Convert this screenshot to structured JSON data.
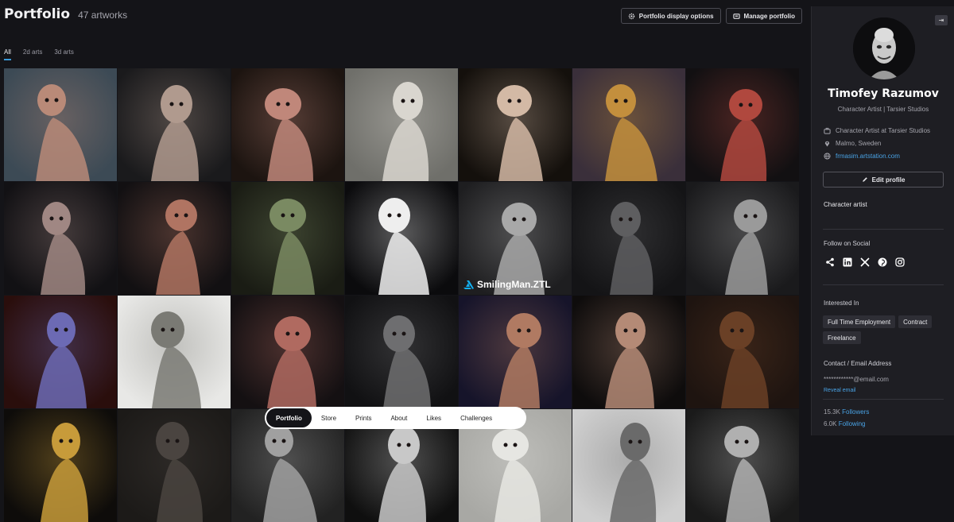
{
  "header": {
    "title": "Portfolio",
    "count": "47 artworks",
    "display_options_label": "Portfolio display options",
    "manage_label": "Manage portfolio"
  },
  "tabs": [
    {
      "label": "All",
      "active": true
    },
    {
      "label": "2d arts",
      "active": false
    },
    {
      "label": "3d arts",
      "active": false
    }
  ],
  "grid": {
    "tile_palettes": [
      [
        "#3c4a55",
        "#b98a78"
      ],
      [
        "#1a1a1c",
        "#b09a8e"
      ],
      [
        "#1c1410",
        "#c0877a"
      ],
      [
        "#6f6f6a",
        "#d9d6cf"
      ],
      [
        "#14100c",
        "#d3b9a5"
      ],
      [
        "#3a2f3a",
        "#c38f3d"
      ],
      [
        "#121012",
        "#b0483e"
      ],
      [
        "#121114",
        "#a08783"
      ],
      [
        "#121012",
        "#b07462"
      ],
      [
        "#1a1c14",
        "#7a8a62"
      ],
      [
        "#0b0b0d",
        "#eeeeee"
      ],
      [
        "#1e1e20",
        "#a8a8a8"
      ],
      [
        "#141416",
        "#5e5e60"
      ],
      [
        "#1a1a1c",
        "#9a9a9a"
      ],
      [
        "#2a0e0c",
        "#6c6ab4"
      ],
      [
        "#e8e8e6",
        "#7a7a74"
      ],
      [
        "#141012",
        "#b06a60"
      ],
      [
        "#111113",
        "#6e6e70"
      ],
      [
        "#16142a",
        "#b07a62"
      ],
      [
        "#0e0c0c",
        "#b48a76"
      ],
      [
        "#1e1410",
        "#6a4026"
      ],
      [
        "#0e0c0a",
        "#c79b3a"
      ],
      [
        "#1c1a18",
        "#4a4440"
      ],
      [
        "#222222",
        "#a0a0a0"
      ],
      [
        "#0f0f0f",
        "#c8c8c8"
      ],
      [
        "#a8a8a4",
        "#e6e6e2"
      ],
      [
        "#cfcfcf",
        "#6a6a6a"
      ],
      [
        "#1a1a1a",
        "#b0b0b0"
      ]
    ],
    "watermark": "SmilingMan.ZTL"
  },
  "bottom_nav": [
    {
      "label": "Portfolio",
      "active": true
    },
    {
      "label": "Store",
      "active": false
    },
    {
      "label": "Prints",
      "active": false
    },
    {
      "label": "About",
      "active": false
    },
    {
      "label": "Likes",
      "active": false
    },
    {
      "label": "Challenges",
      "active": false
    }
  ],
  "profile": {
    "name": "Timofey Razumov",
    "headline": "Character Artist | Tarsier Studios",
    "job": "Character Artist at Tarsier Studios",
    "location": "Malmo, Sweden",
    "website": "frmasim.artstation.com",
    "edit_label": "Edit profile",
    "bio": "Character artist",
    "social_title": "Follow on Social",
    "social_icons": [
      "share-icon",
      "linkedin-icon",
      "x-icon",
      "pinterest-icon",
      "instagram-icon"
    ],
    "interested_title": "Interested In",
    "interests": [
      "Full Time Employment",
      "Contract",
      "Freelance"
    ],
    "contact_title": "Contact / Email Address",
    "email": "************@email.com",
    "reveal_label": "Reveal email",
    "followers_count": "15.3K",
    "followers_label": "Followers",
    "following_count": "6.0K",
    "following_label": "Following"
  },
  "colors": {
    "background": "#141418",
    "sidebar": "#1e1e23",
    "accent": "#49a2e4"
  }
}
